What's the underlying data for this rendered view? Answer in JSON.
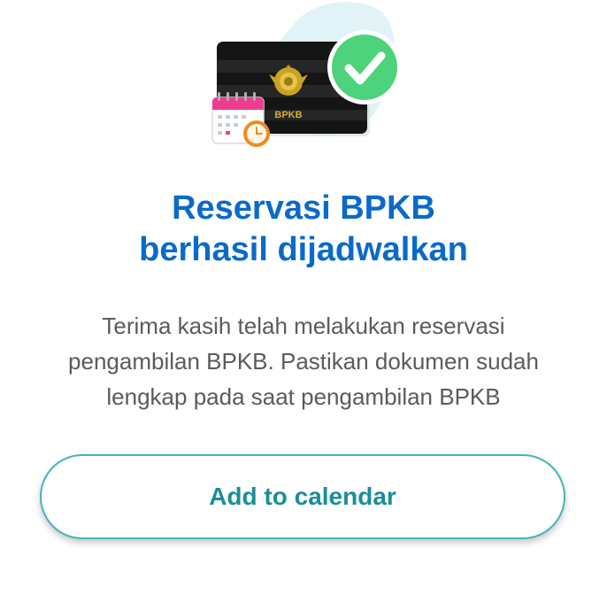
{
  "illustration": {
    "card_text": "BPKB"
  },
  "title": {
    "line1": "Reservasi BPKB",
    "line2": "berhasil dijadwalkan"
  },
  "description": {
    "line1": "Terima kasih telah melakukan reservasi",
    "line2": "pengambilan BPKB. Pastikan dokumen sudah",
    "line3": "lengkap pada saat pengambilan BPKB"
  },
  "actions": {
    "add_to_calendar_label": "Add to calendar"
  },
  "colors": {
    "title": "#0a6ac9",
    "button_border": "#43b6b9",
    "button_text": "#1a8e99",
    "check_green": "#4cd37b",
    "calendar_pink": "#ee3d8f",
    "clock_orange": "#f08a24"
  }
}
